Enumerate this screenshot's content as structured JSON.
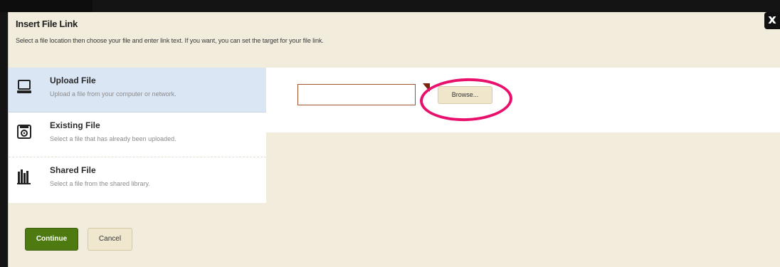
{
  "dialog": {
    "title": "Insert File Link",
    "subtitle": "Select a file location then choose your file and enter link text. If you want, you can set the target for your file link.",
    "close_label": "x"
  },
  "options": [
    {
      "title": "Upload File",
      "description": "Upload a file from your computer or network.",
      "icon": "computer-icon",
      "selected": true
    },
    {
      "title": "Existing File",
      "description": "Select a file that has already been uploaded.",
      "icon": "disk-icon",
      "selected": false
    },
    {
      "title": "Shared File",
      "description": "Select a file from the shared library.",
      "icon": "library-icon",
      "selected": false
    }
  ],
  "upload": {
    "file_value": "",
    "browse_label": "Browse..."
  },
  "footer": {
    "continue_label": "Continue",
    "cancel_label": "Cancel"
  },
  "colors": {
    "dialog_bg": "#f1ecdc",
    "selected_bg": "#dbe6f5",
    "continue_bg": "#4e7a12",
    "highlight": "#e8106c",
    "input_border": "#a0522d"
  }
}
